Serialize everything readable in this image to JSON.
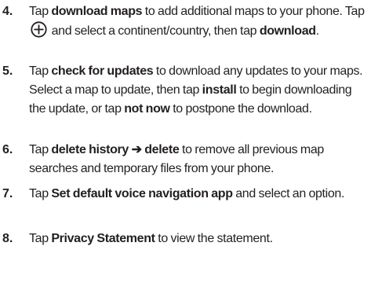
{
  "steps": [
    {
      "number": "4.",
      "parts": [
        {
          "text": "Tap "
        },
        {
          "text": "download maps",
          "bold": true
        },
        {
          "text": " to add additional maps to your phone. Tap "
        },
        {
          "icon": "circle-plus-icon"
        },
        {
          "text": " and select a continent/country, then tap "
        },
        {
          "text": "download",
          "bold": true
        },
        {
          "text": "."
        }
      ]
    },
    {
      "number": "5.",
      "parts": [
        {
          "text": "Tap "
        },
        {
          "text": "check for updates",
          "bold": true
        },
        {
          "text": " to download any updates to your maps. Select a map to update, then tap "
        },
        {
          "text": "install",
          "bold": true
        },
        {
          "text": " to begin downloading the update, or tap "
        },
        {
          "text": "not now",
          "bold": true
        },
        {
          "text": " to postpone the download."
        }
      ]
    },
    {
      "number": "6.",
      "parts": [
        {
          "text": "Tap "
        },
        {
          "text": "delete history ➔ delete",
          "bold": true
        },
        {
          "text": " to remove all previous map searches and temporary files from your phone."
        }
      ]
    },
    {
      "number": "7.",
      "parts": [
        {
          "text": "Tap "
        },
        {
          "text": "Set default voice navigation app",
          "bold": true
        },
        {
          "text": " and select an option."
        }
      ]
    },
    {
      "number": "8.",
      "parts": [
        {
          "text": "Tap "
        },
        {
          "text": "Privacy Statement",
          "bold": true
        },
        {
          "text": " to view the statement."
        }
      ]
    }
  ]
}
